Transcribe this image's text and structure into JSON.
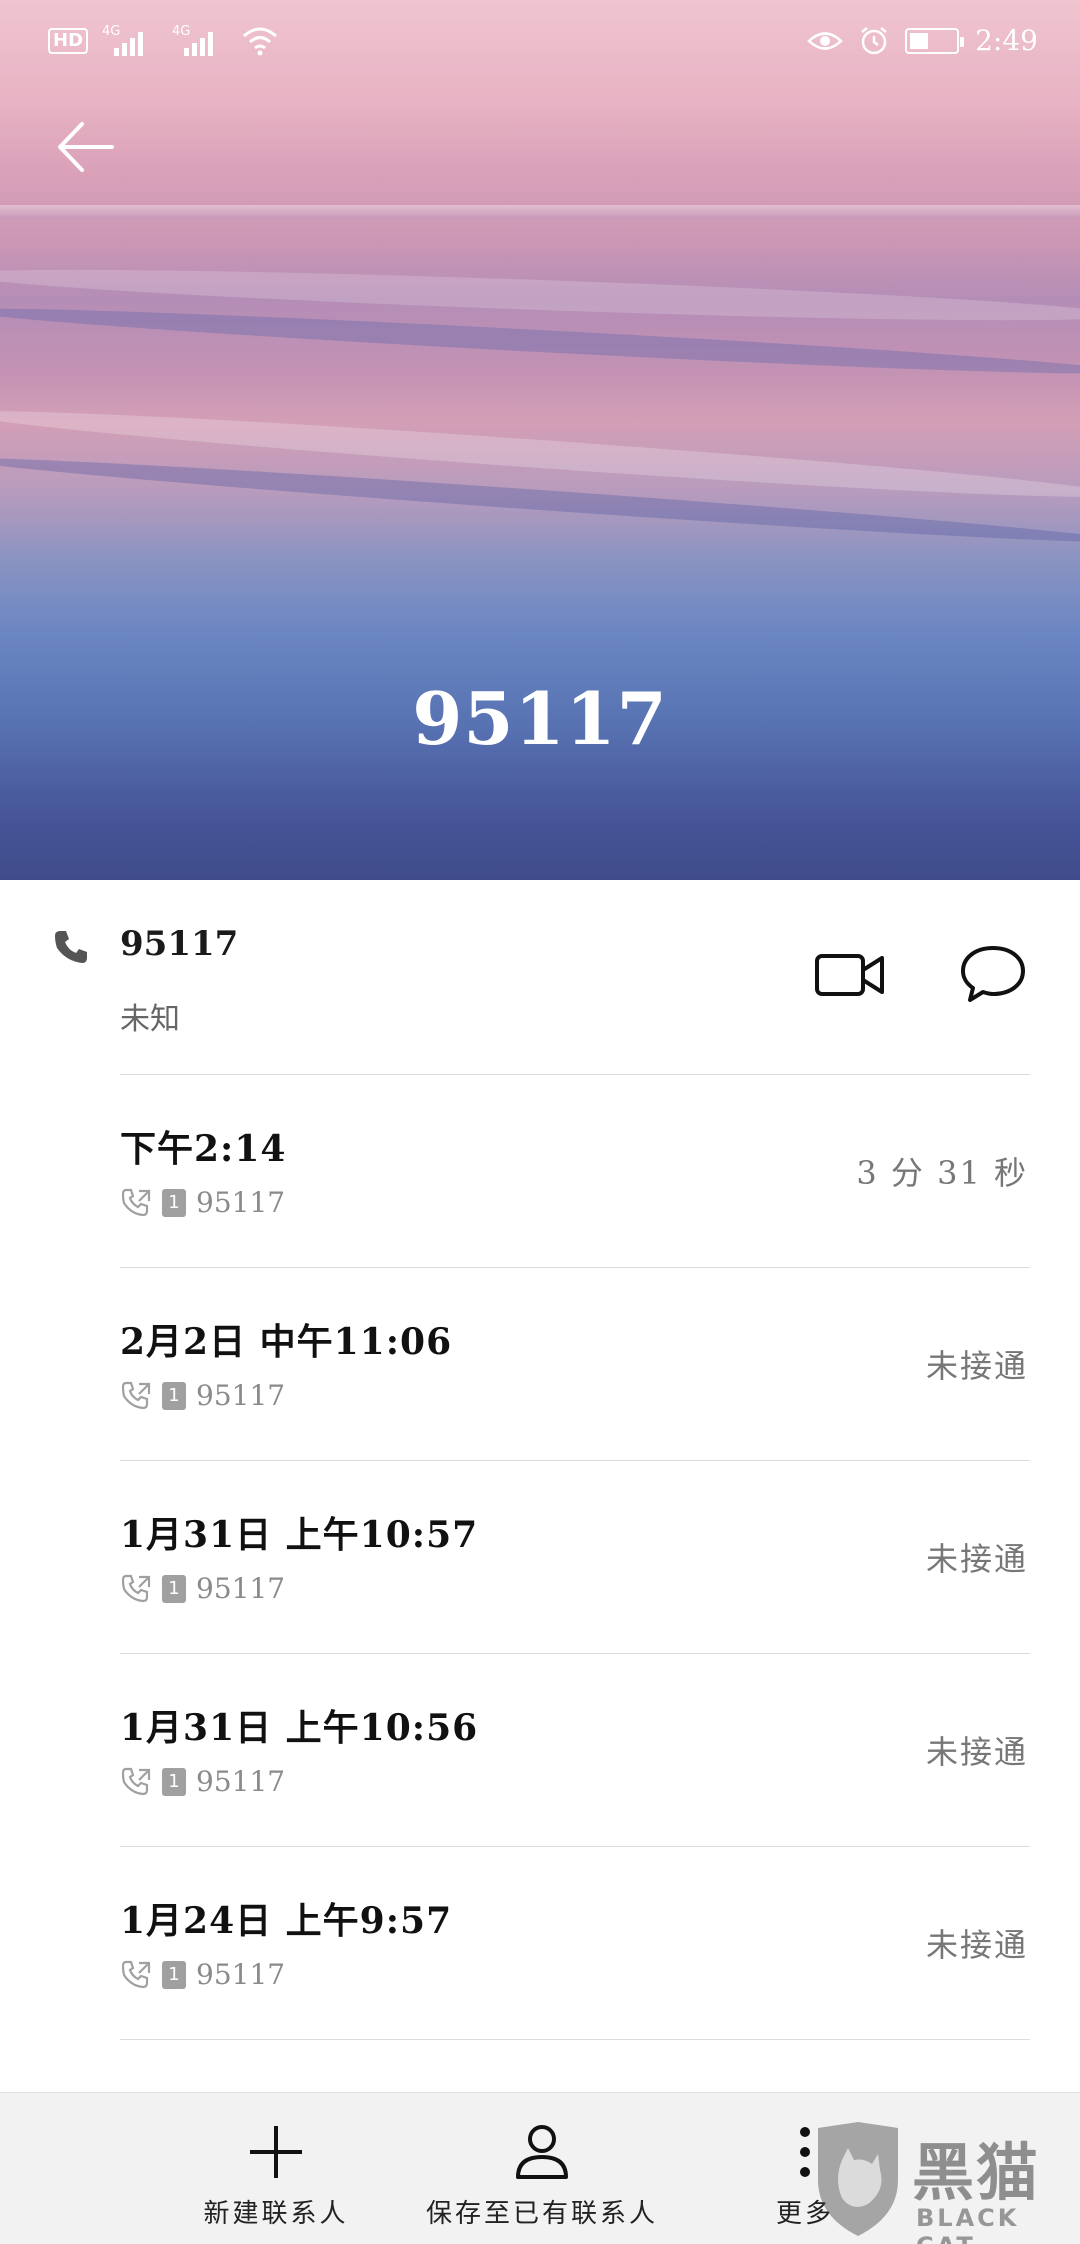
{
  "status_bar": {
    "hd_label": "HD",
    "network_1": "4G",
    "network_2": "4G",
    "time": "2:49",
    "icons": [
      "hd-icon",
      "signal-icon",
      "signal-icon",
      "wifi-icon",
      "eye-icon",
      "alarm-icon",
      "battery-icon"
    ]
  },
  "hero": {
    "title": "95117",
    "back_icon": "arrow-left-icon"
  },
  "contact": {
    "number": "95117",
    "location": "未知",
    "icons": [
      "phone-icon",
      "video-call-icon",
      "message-icon"
    ]
  },
  "call_log": [
    {
      "time": "下午2:14",
      "sim": "1",
      "number": "95117",
      "status": "3 分 31 秒"
    },
    {
      "time": "2月2日  中午11:06",
      "sim": "1",
      "number": "95117",
      "status": "未接通"
    },
    {
      "time": "1月31日  上午10:57",
      "sim": "1",
      "number": "95117",
      "status": "未接通"
    },
    {
      "time": "1月31日  上午10:56",
      "sim": "1",
      "number": "95117",
      "status": "未接通"
    },
    {
      "time": "1月24日  上午9:57",
      "sim": "1",
      "number": "95117",
      "status": "未接通"
    }
  ],
  "bottom_bar": {
    "new_contact": "新建联系人",
    "save_existing": "保存至已有联系人",
    "more": "更多"
  },
  "watermark": {
    "cn": "黑猫",
    "en": "BLACK CAT"
  },
  "colors": {
    "hero_top": "#f0c4d0",
    "hero_bottom": "#3f4b8a",
    "status_gray": "#777777",
    "bottom_bar_bg": "#f2f2f2"
  }
}
